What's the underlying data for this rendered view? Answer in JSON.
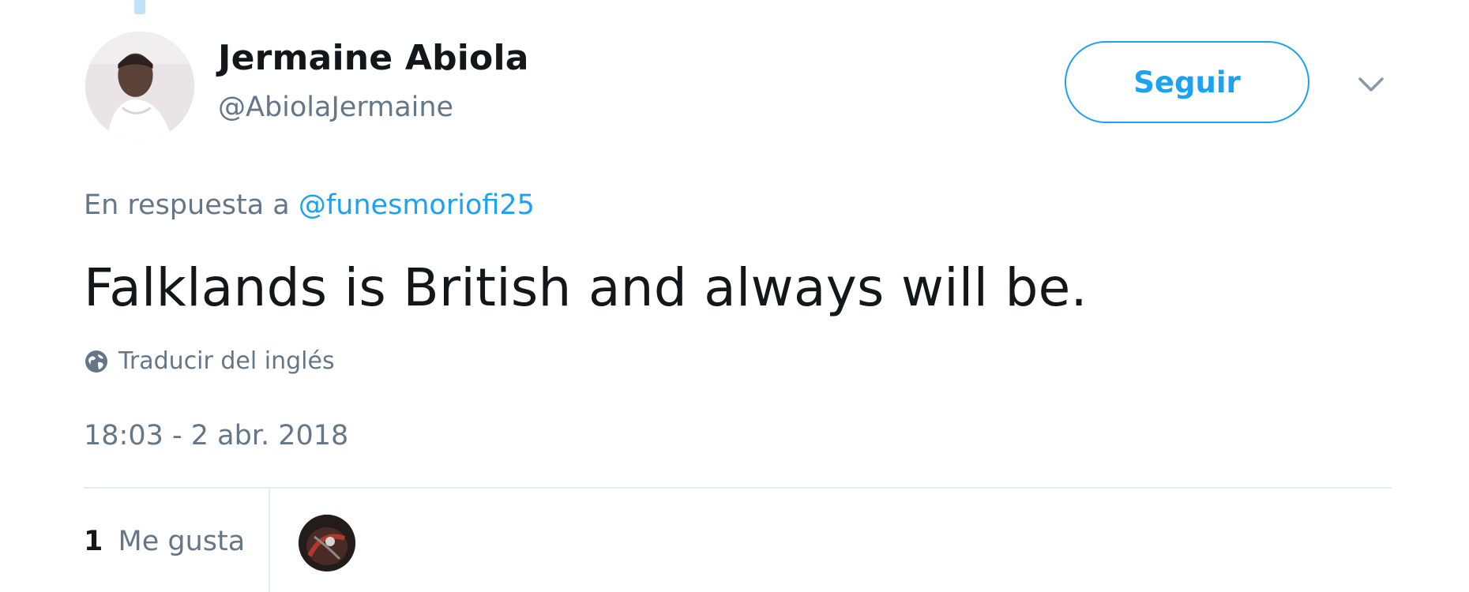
{
  "tweet": {
    "author": {
      "display_name": "Jermaine Abiola",
      "handle": "@AbiolaJermaine"
    },
    "follow_label": "Seguir",
    "reply_context": {
      "prefix": "En respuesta a",
      "mention": "@funesmoriofi25"
    },
    "text": "Falklands is British and always will be.",
    "translate_label": "Traducir del inglés",
    "timestamp": "18:03 - 2 abr. 2018",
    "stats": {
      "likes_count": "1",
      "likes_label": "Me gusta"
    }
  },
  "icons": {
    "menu": "chevron-down-icon",
    "translate": "globe-icon"
  },
  "colors": {
    "accent": "#1da1f2",
    "secondary_text": "#657786",
    "primary_text": "#14171a",
    "divider": "#e6ecf0"
  }
}
